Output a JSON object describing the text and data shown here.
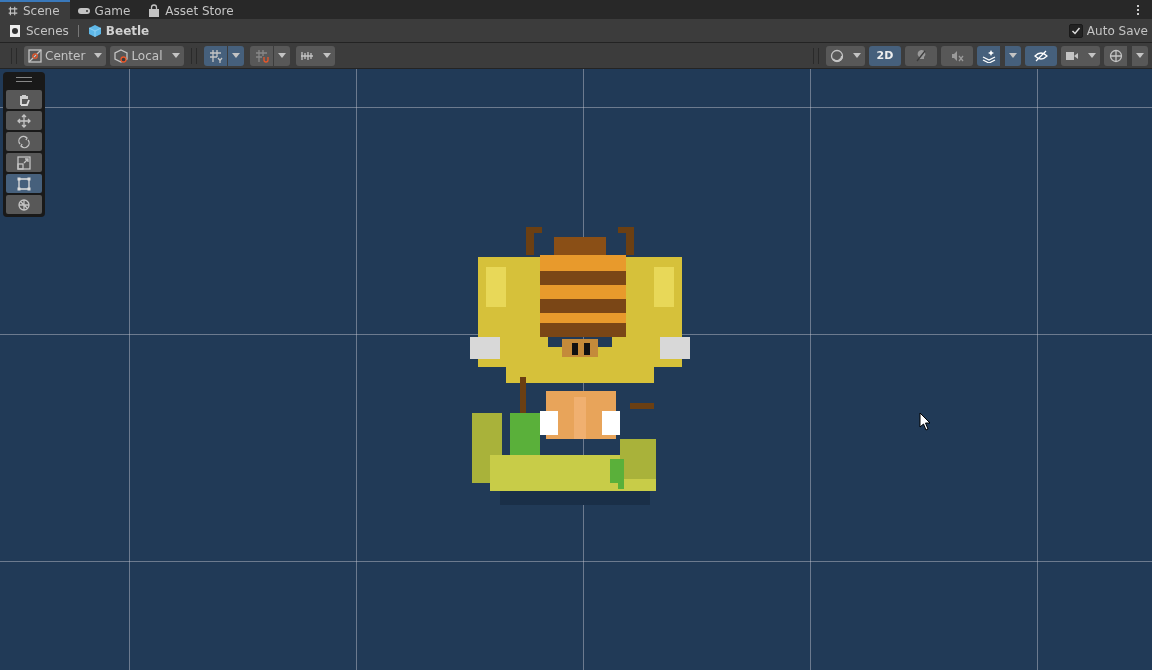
{
  "tabs": [
    {
      "label": "Scene",
      "selected": true
    },
    {
      "label": "Game",
      "selected": false
    },
    {
      "label": "Asset Store",
      "selected": false
    }
  ],
  "breadcrumbs": [
    {
      "label": "Scenes",
      "current": false
    },
    {
      "label": "Beetle",
      "current": true
    }
  ],
  "auto_save": {
    "label": "Auto Save",
    "checked": true
  },
  "toolbar": {
    "left": [
      {
        "kind": "dropdown",
        "label": "Center"
      },
      {
        "kind": "dropdown",
        "label": "Local"
      },
      {
        "kind": "split",
        "selected": true
      },
      {
        "kind": "split",
        "selected": false
      },
      {
        "kind": "dropdown",
        "selected": false
      }
    ],
    "right": [
      {
        "kind": "dropdown",
        "selected": false
      },
      {
        "kind": "toggle",
        "label": "2D",
        "selected": true
      },
      {
        "kind": "toggle",
        "selected": false
      },
      {
        "kind": "toggle",
        "selected": false
      },
      {
        "kind": "split",
        "selected": true
      },
      {
        "kind": "toggle",
        "selected": true
      },
      {
        "kind": "dropdown",
        "selected": false
      },
      {
        "kind": "split",
        "selected": false
      }
    ]
  },
  "tools": [
    {
      "selected": false
    },
    {
      "selected": false
    },
    {
      "selected": false
    },
    {
      "selected": false
    },
    {
      "selected": true
    },
    {
      "selected": false
    }
  ]
}
